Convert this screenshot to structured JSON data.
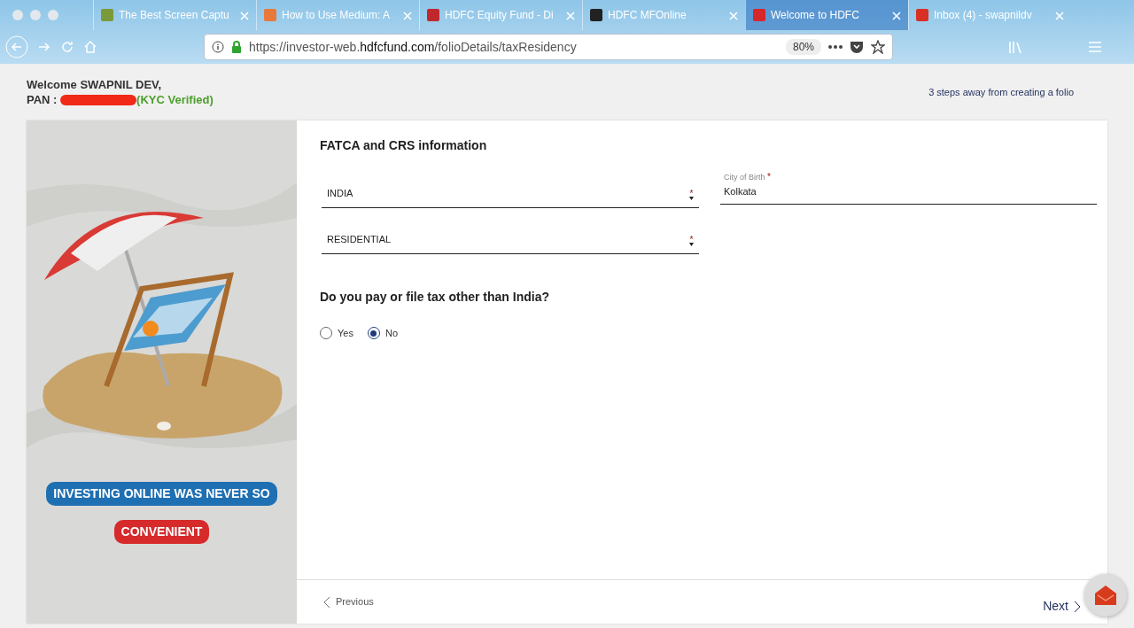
{
  "browser": {
    "tabs": [
      {
        "title": "The Best Screen Captu",
        "selected": false,
        "color": "#7a9a3a"
      },
      {
        "title": "How to Use Medium: A",
        "selected": false,
        "color": "#e8793a"
      },
      {
        "title": "HDFC Equity Fund - Di",
        "selected": false,
        "color": "#c0282d"
      },
      {
        "title": "HDFC MFOnline",
        "selected": false,
        "color": "#222222"
      },
      {
        "title": "Welcome to HDFC",
        "selected": true,
        "color": "#d5262b"
      },
      {
        "title": "Inbox (4) - swapnildv",
        "selected": false,
        "color": "#d93025"
      }
    ],
    "url_prefix": "https://investor-web.",
    "url_host": "hdfcfund.com",
    "url_path": "/folioDetails/taxResidency",
    "zoom": "80%"
  },
  "header": {
    "welcome": "Welcome SWAPNIL DEV,",
    "pan_label": "PAN :",
    "kyc_status": "(KYC Verified)",
    "steps_note": "3 steps away from creating a folio"
  },
  "banner": {
    "line_1": "INVESTING ONLINE WAS NEVER SO",
    "line_2": "CONVENIENT"
  },
  "form": {
    "title": "FATCA and CRS information",
    "fields": [
      {
        "kind": "select",
        "value": "INDIA",
        "required_mark": "*"
      },
      {
        "kind": "text",
        "label": "City of Birth",
        "value": "Kolkata",
        "required_mark": "*"
      },
      {
        "kind": "select",
        "value": "RESIDENTIAL",
        "required_mark": "*"
      }
    ],
    "question": "Do you pay or file tax other than India?",
    "options": [
      {
        "label": "Yes",
        "selected": false
      },
      {
        "label": "No",
        "selected": true
      }
    ]
  },
  "footer": {
    "previous": "Previous",
    "next": "Next"
  }
}
